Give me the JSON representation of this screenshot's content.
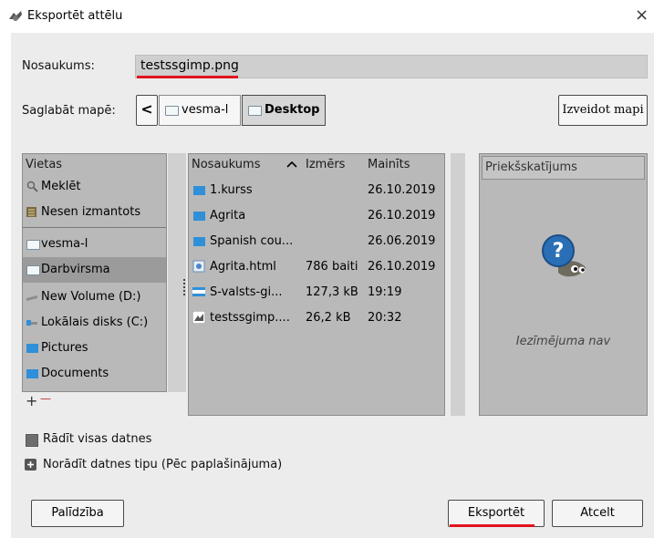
{
  "window": {
    "title": "Eksportēt attēlu",
    "close_glyph": "×"
  },
  "name_row": {
    "label": "Nosaukums:",
    "value": "testssgimp.png"
  },
  "folder_row": {
    "label": "Saglabāt mapē:",
    "back_glyph": "<",
    "crumbs": [
      "vesma-l",
      "Desktop"
    ],
    "create_folder_label": "Izveidot mapi"
  },
  "places": {
    "header": "Vietas",
    "items": [
      {
        "label": "Meklēt",
        "icon": "search-icon"
      },
      {
        "label": "Nesen izmantots",
        "icon": "recent-icon"
      },
      {
        "label": "vesma-l",
        "icon": "folder-icon"
      },
      {
        "label": "Darbvirsma",
        "icon": "folder-icon"
      },
      {
        "label": "New Volume (D:)",
        "icon": "drive-icon"
      },
      {
        "label": "Lokālais disks (C:)",
        "icon": "drive-icon"
      },
      {
        "label": "Pictures",
        "icon": "folder-icon"
      },
      {
        "label": "Documents",
        "icon": "folder-icon"
      }
    ],
    "add_glyph": "+",
    "remove_glyph": "—"
  },
  "files": {
    "columns": {
      "name": "Nosaukums",
      "sort_glyph": "^",
      "size": "Izmērs",
      "modified": "Mainīts"
    },
    "rows": [
      {
        "name": "1.kurss",
        "size": "",
        "modified": "26.10.2019",
        "icon": "folder-icon"
      },
      {
        "name": "Agrita",
        "size": "",
        "modified": "26.10.2019",
        "icon": "folder-icon"
      },
      {
        "name": "Spanish cou...",
        "size": "",
        "modified": "26.06.2019",
        "icon": "folder-icon"
      },
      {
        "name": "Agrita.html",
        "size": "786 baiti",
        "modified": "26.10.2019",
        "icon": "html-file-icon"
      },
      {
        "name": "S-valsts-gi...",
        "size": "127,3 kB",
        "modified": "19:19",
        "icon": "image-file-icon"
      },
      {
        "name": "testssgimp....",
        "size": "26,2 kB",
        "modified": "20:32",
        "icon": "gimp-file-icon"
      }
    ]
  },
  "preview": {
    "header": "Priekšskatījums",
    "empty_text": "Iezīmējuma nav"
  },
  "options": {
    "show_all": "Rādīt visas datnes",
    "file_type": "Norādīt datnes tipu (Pēc paplašinājuma)"
  },
  "buttons": {
    "help": "Palīdzība",
    "export": "Eksportēt",
    "cancel": "Atcelt"
  },
  "colors": {
    "highlight_red": "#e0141e",
    "panel_gray": "#b9b9b9",
    "folder_blue": "#2f8fd8"
  }
}
